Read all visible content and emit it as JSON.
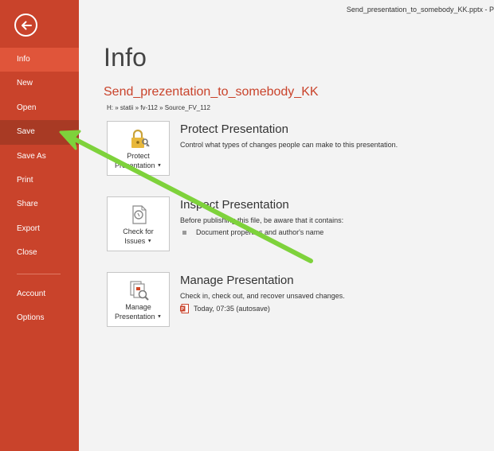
{
  "window": {
    "title": "Send_presentation_to_somebody_KK.pptx - P"
  },
  "sidebar": {
    "items": [
      {
        "label": "Info"
      },
      {
        "label": "New"
      },
      {
        "label": "Open"
      },
      {
        "label": "Save"
      },
      {
        "label": "Save As"
      },
      {
        "label": "Print"
      },
      {
        "label": "Share"
      },
      {
        "label": "Export"
      },
      {
        "label": "Close"
      }
    ],
    "bottom_items": [
      {
        "label": "Account"
      },
      {
        "label": "Options"
      }
    ]
  },
  "main": {
    "title": "Info",
    "file_name": "Send_prezentation_to_somebody_KK",
    "file_path": "H: » statii » fv-112 » Source_FV_112",
    "sections": [
      {
        "tile_line1": "Protect",
        "tile_line2": "Presentation",
        "title": "Protect Presentation",
        "description": "Control what types of changes people can make to this presentation."
      },
      {
        "tile_line1": "Check for",
        "tile_line2": "Issues",
        "title": "Inspect Presentation",
        "description": "Before publishing this file, be aware that it contains:",
        "bullet": "Document properties and author's name"
      },
      {
        "tile_line1": "Manage",
        "tile_line2": "Presentation",
        "title": "Manage Presentation",
        "description": "Check in, check out, and recover unsaved changes.",
        "version": "Today, 07:35 (autosave)"
      }
    ]
  },
  "colors": {
    "sidebar": "#c9432b",
    "accent": "#c9432b",
    "arrow": "#7ed23b"
  }
}
